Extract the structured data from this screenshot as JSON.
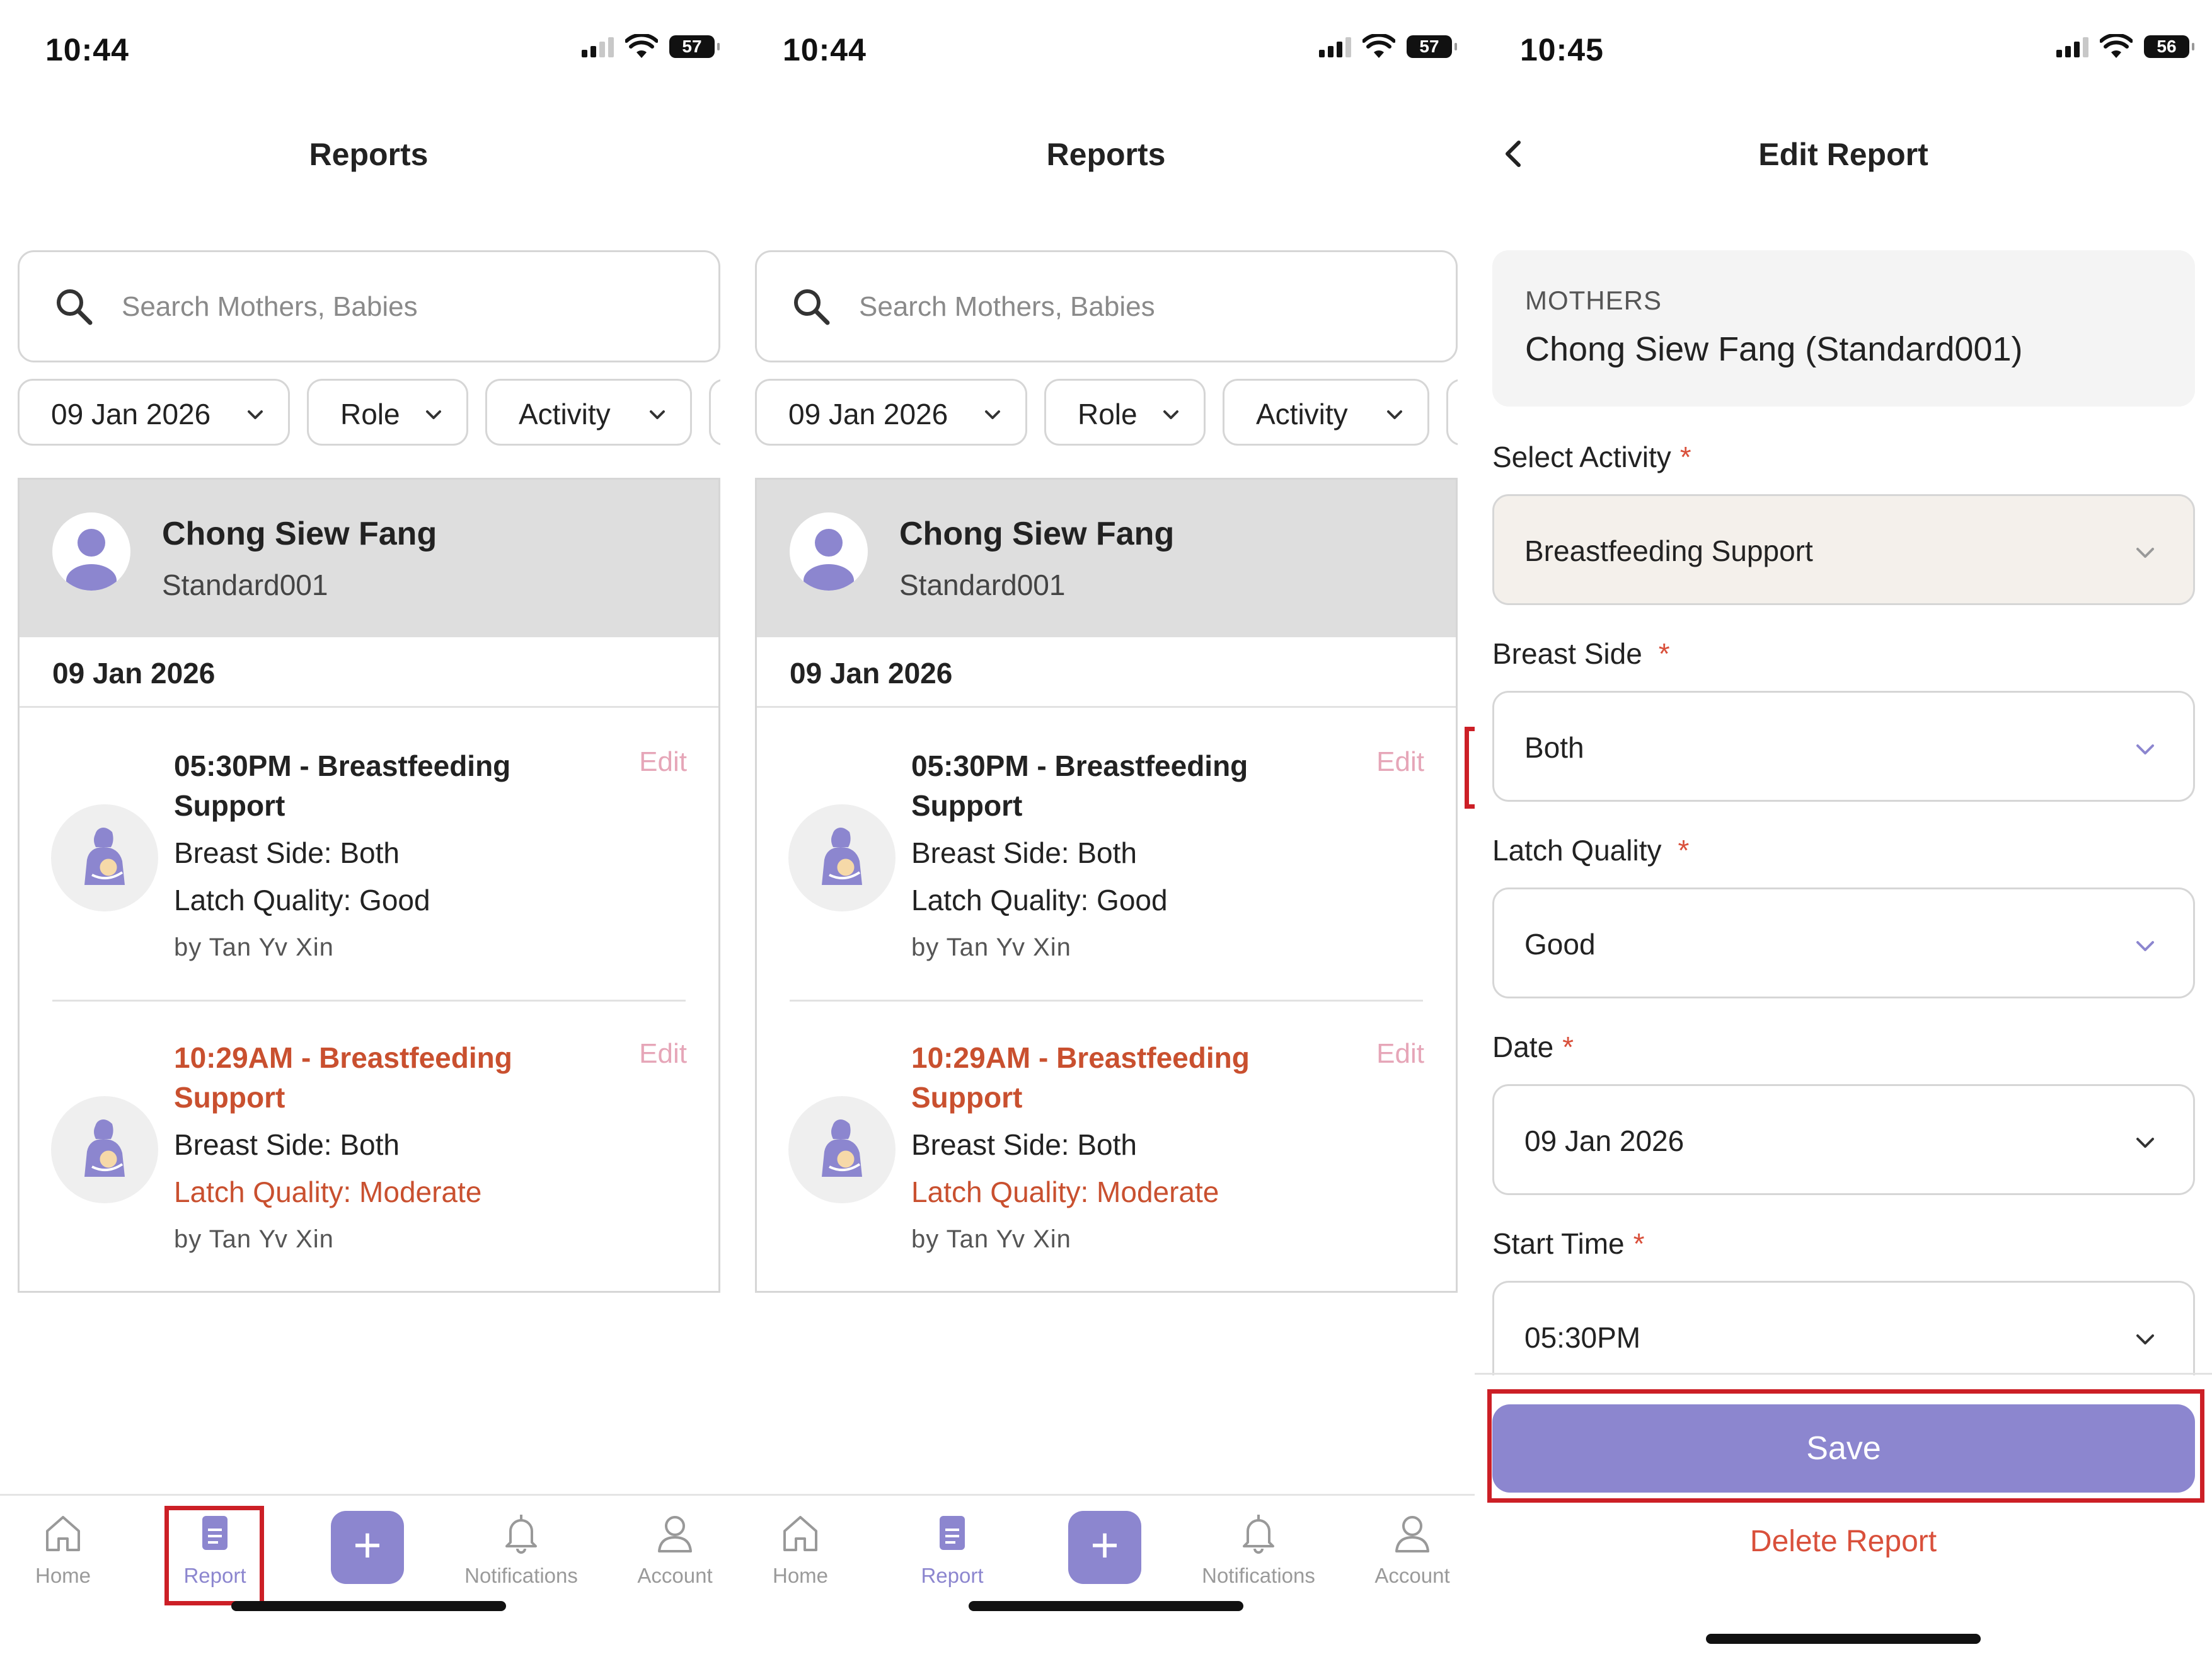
{
  "screens": [
    {
      "status": {
        "time": "10:44",
        "battery": "57"
      },
      "header": {
        "title": "Reports"
      },
      "search": {
        "placeholder": "Search Mothers, Babies"
      },
      "filters": {
        "date": "09 Jan 2026",
        "role": "Role",
        "activity": "Activity"
      },
      "patient": {
        "name": "Chong Siew Fang",
        "id": "Standard001"
      },
      "date_heading": "09 Jan 2026",
      "entries": [
        {
          "title": "05:30PM - Breastfeeding Support",
          "edit": "Edit",
          "breast_side": "Breast Side: Both",
          "latch": "Latch Quality: Good",
          "by": "by Tan Yv Xin"
        },
        {
          "title": "10:29AM - Breastfeeding Support",
          "edit": "Edit",
          "breast_side": "Breast Side: Both",
          "latch": "Latch Quality: Moderate",
          "by": "by Tan Yv Xin"
        }
      ],
      "nav": {
        "home": "Home",
        "report": "Report",
        "add": "+",
        "notifications": "Notifications",
        "account": "Account"
      }
    },
    {
      "status": {
        "time": "10:44",
        "battery": "57"
      },
      "header": {
        "title": "Reports"
      },
      "search": {
        "placeholder": "Search Mothers, Babies"
      },
      "filters": {
        "date": "09 Jan 2026",
        "role": "Role",
        "activity": "Activity"
      },
      "patient": {
        "name": "Chong Siew Fang",
        "id": "Standard001"
      },
      "date_heading": "09 Jan 2026",
      "entries": [
        {
          "title": "05:30PM - Breastfeeding Support",
          "edit": "Edit",
          "breast_side": "Breast Side: Both",
          "latch": "Latch Quality: Good",
          "by": "by Tan Yv Xin"
        },
        {
          "title": "10:29AM - Breastfeeding Support",
          "edit": "Edit",
          "breast_side": "Breast Side: Both",
          "latch": "Latch Quality: Moderate",
          "by": "by Tan Yv Xin"
        }
      ],
      "nav": {
        "home": "Home",
        "report": "Report",
        "add": "+",
        "notifications": "Notifications",
        "account": "Account"
      }
    },
    {
      "status": {
        "time": "10:45",
        "battery": "56"
      },
      "header": {
        "title": "Edit Report"
      },
      "mothers": {
        "label": "MOTHERS",
        "value": "Chong Siew Fang (Standard001)"
      },
      "form": {
        "activity": {
          "label": "Select Activity",
          "required": "*",
          "value": "Breastfeeding Support"
        },
        "breast_side": {
          "label": "Breast Side",
          "required": "*",
          "value": "Both"
        },
        "latch": {
          "label": "Latch Quality",
          "required": "*",
          "value": "Good"
        },
        "date": {
          "label": "Date",
          "required": "*",
          "value": "09 Jan 2026"
        },
        "start_time": {
          "label": "Start Time",
          "required": "*",
          "value": "05:30PM"
        }
      },
      "save_label": "Save",
      "delete_label": "Delete Report"
    }
  ],
  "colors": {
    "accent": "#8c86cf",
    "warning": "#c9502f",
    "edit": "#e6a6b8",
    "highlight": "#cc1f26",
    "danger": "#d9503b"
  }
}
